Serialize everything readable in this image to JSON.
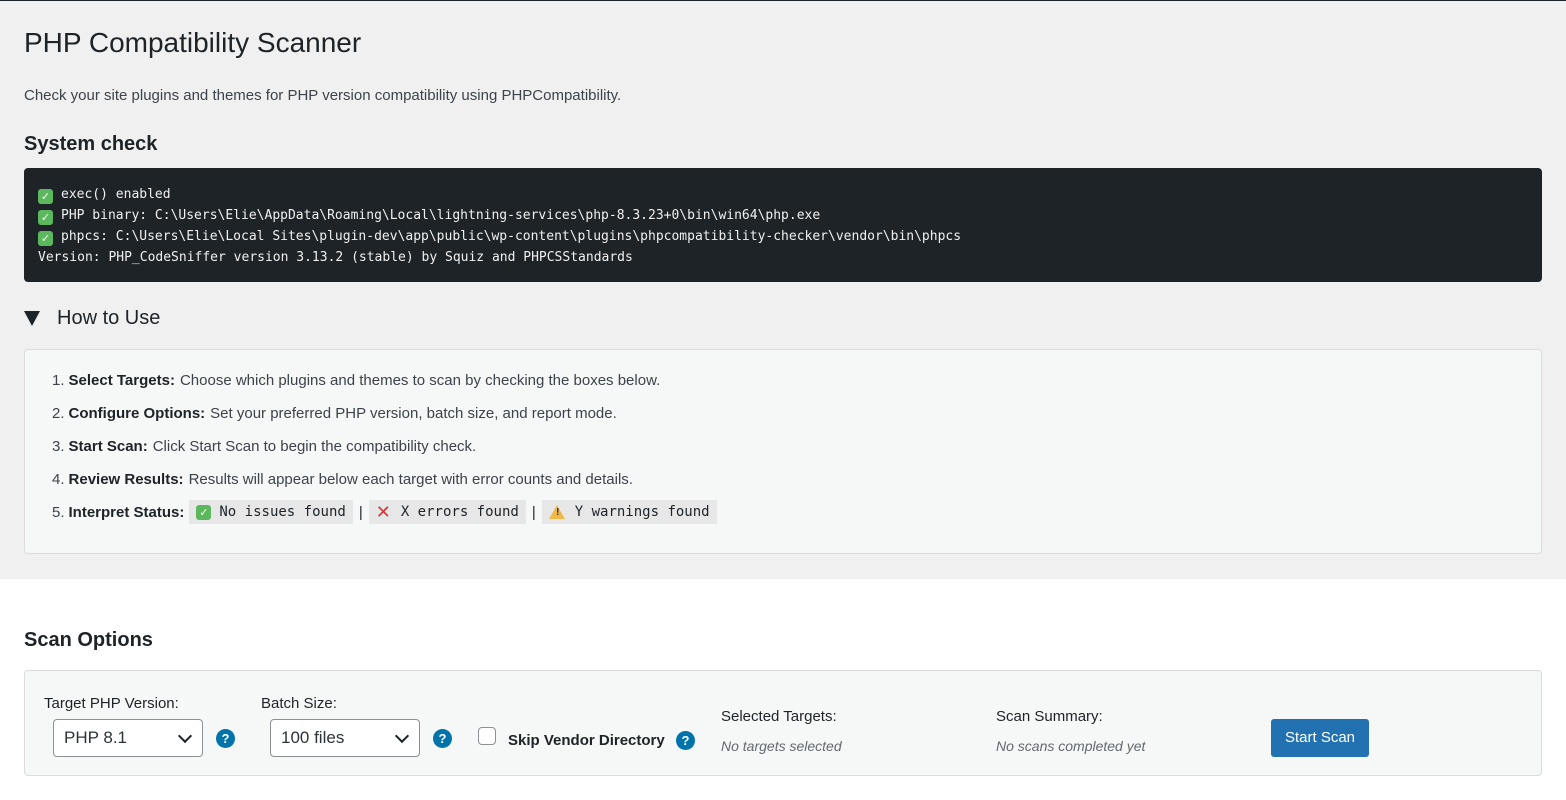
{
  "page": {
    "title": "PHP Compatibility Scanner",
    "intro": "Check your site plugins and themes for PHP version compatibility using PHPCompatibility."
  },
  "system_check": {
    "heading": "System check",
    "lines": [
      {
        "ok": true,
        "text": "exec() enabled"
      },
      {
        "ok": true,
        "text": "PHP binary: C:\\Users\\Elie\\AppData\\Roaming\\Local\\lightning-services\\php-8.3.23+0\\bin\\win64\\php.exe"
      },
      {
        "ok": true,
        "text": "phpcs: C:\\Users\\Elie\\Local Sites\\plugin-dev\\app\\public\\wp-content\\plugins\\phpcompatibility-checker\\vendor\\bin\\phpcs"
      },
      {
        "ok": false,
        "text": "Version: PHP_CodeSniffer version 3.13.2 (stable) by Squiz and PHPCSStandards"
      }
    ]
  },
  "how_to_use": {
    "title": "How to Use",
    "expanded": true,
    "steps": [
      {
        "num": "1.",
        "label": "Select Targets:",
        "text": "Choose which plugins and themes to scan by checking the boxes below."
      },
      {
        "num": "2.",
        "label": "Configure Options:",
        "text": "Set your preferred PHP version, batch size, and report mode."
      },
      {
        "num": "3.",
        "label": "Start Scan:",
        "text": "Click Start Scan to begin the compatibility check."
      },
      {
        "num": "4.",
        "label": "Review Results:",
        "text": "Results will appear below each target with error counts and details."
      },
      {
        "num": "5.",
        "label": "Interpret Status:",
        "text": ""
      }
    ],
    "status_legend": {
      "ok": "No issues found",
      "error": "X errors found",
      "warning": "Y warnings found",
      "separator": "|"
    }
  },
  "scan_options": {
    "heading": "Scan Options",
    "php_version": {
      "label": "Target PHP Version:",
      "value": "PHP 8.1"
    },
    "batch_size": {
      "label": "Batch Size:",
      "value": "100 files"
    },
    "skip_vendor": {
      "label": "Skip Vendor Directory",
      "checked": false
    },
    "selected_targets": {
      "label": "Selected Targets:",
      "value": "No targets selected"
    },
    "scan_summary": {
      "label": "Scan Summary:",
      "value": "No scans completed yet"
    },
    "start_button": "Start Scan",
    "help_glyph": "?"
  },
  "icons": {
    "check": "check-icon",
    "cross": "cross-icon",
    "warning": "warning-icon",
    "help": "help-icon"
  },
  "colors": {
    "console_bg": "#1d2327",
    "check_green": "#5cb85c",
    "error_red": "#d63638",
    "warning_yellow": "#f0b849",
    "help_blue": "#0073aa",
    "primary_button": "#2271b1"
  }
}
